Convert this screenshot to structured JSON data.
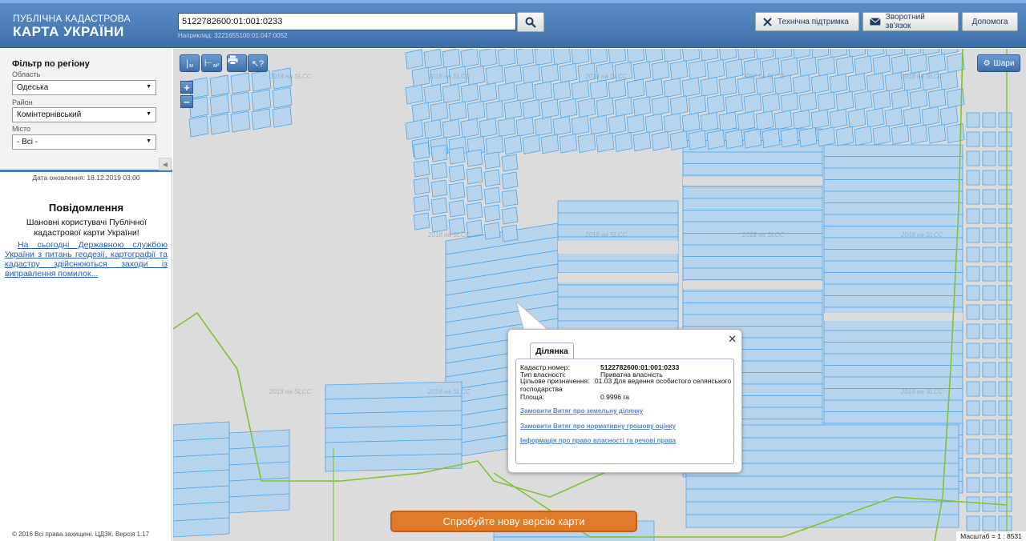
{
  "header": {
    "logo_line1": "ПУБЛІЧНА КАДАСТРОВА",
    "logo_line2": "КАРТА УКРАЇНИ",
    "search_value": "5122782600:01:001:0233",
    "search_hint": "Наприклад: 3221655100:01:047:0052",
    "support_label": "Технічна підтримка",
    "feedback_label": "Зворотний зв'язок",
    "help_label": "Допомога"
  },
  "sidebar": {
    "filter_title": "Фільтр по регіону",
    "region_label": "Область",
    "region_value": "Одеська",
    "district_label": "Район",
    "district_value": "Комінтернівський",
    "city_label": "Місто",
    "city_value": "- Всі -",
    "update_date": "Дата оновлення: 18.12.2019 03:00",
    "news_title": "Повідомлення",
    "news_greeting": "Шановні користувачі Публічної кадастрової карти України!",
    "news_link": "На сьогодні Державною службою України з питань геодезії, картографії та кадастру здійснюються заходи із виправлення помилок...",
    "copyright": "© 2016 Всі права захищені. ЦДЗК. Версія 1.17"
  },
  "map": {
    "tool_measure_label": "м",
    "tool_area_label": "м²",
    "layers_label": "Шари",
    "watermark": "2018 на SLCC",
    "new_version_label": "Спробуйте нову версію карти",
    "scale_text": "Масштаб = 1 : 8531"
  },
  "popup": {
    "tab_label": "Ділянка",
    "rows": [
      {
        "label": "Кадастр.номер:",
        "value": "5122782600:01:001:0233"
      },
      {
        "label": "Тип власності:",
        "value": "Приватна власність"
      },
      {
        "label": "Цільове призначення:",
        "value": "01.03 Для ведення особистого селянського господарства"
      },
      {
        "label": "Площа:",
        "value": "0.9996 га"
      }
    ],
    "link1": "Замовити Витяг про земельну ділянку",
    "link2": "Замовити Витяг про нормативну грошову оцінку",
    "link3": "Інформація про право власності та речові права"
  },
  "colors": {
    "header": "#4a7db8",
    "parcel_fill": "#b8d4ec",
    "parcel_stroke": "#4aa3e6",
    "boundary": "#7cc230",
    "accent_button": "#e07b2a"
  }
}
